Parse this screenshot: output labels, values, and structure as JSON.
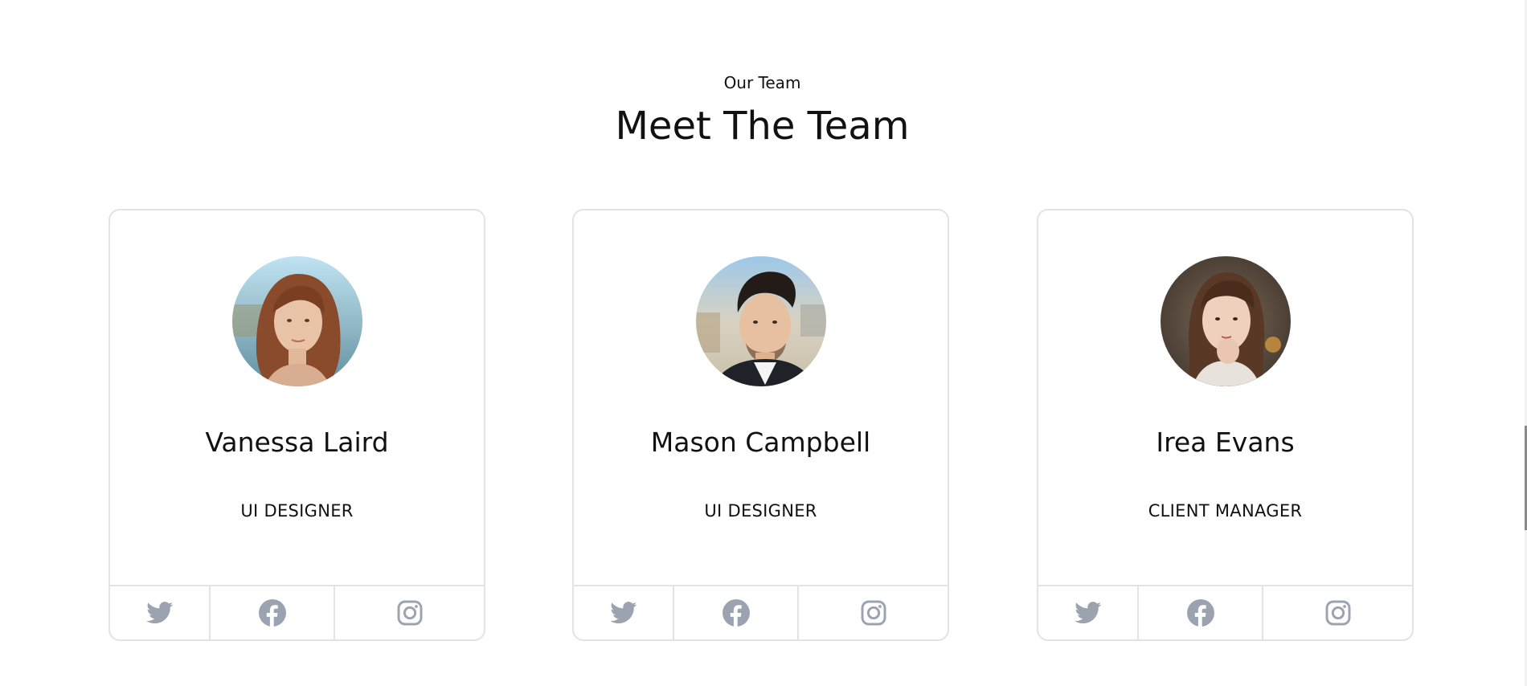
{
  "section": {
    "eyebrow": "Our Team",
    "title": "Meet The Team"
  },
  "members": [
    {
      "name": "Vanessa Laird",
      "role": "UI DESIGNER"
    },
    {
      "name": "Mason Campbell",
      "role": "UI DESIGNER"
    },
    {
      "name": "Irea Evans",
      "role": "CLIENT MANAGER"
    }
  ],
  "social_icons": [
    "twitter-icon",
    "facebook-icon",
    "instagram-icon"
  ],
  "colors": {
    "icon": "#9ca3b0",
    "border": "#e3e3e6",
    "text": "#111111"
  }
}
